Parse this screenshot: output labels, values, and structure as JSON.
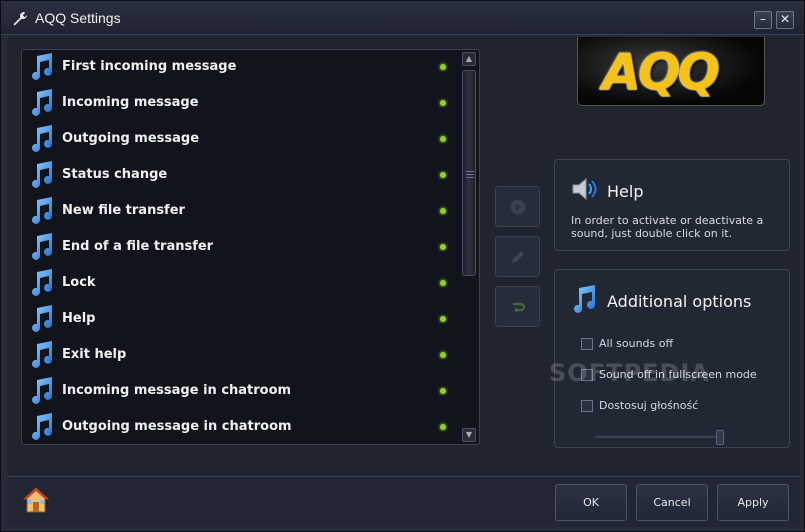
{
  "window": {
    "title": "AQQ Settings",
    "minimize_glyph": "–",
    "close_glyph": "✕"
  },
  "logo": {
    "text": "AQQ"
  },
  "sound_list": {
    "items": [
      {
        "label": "First incoming message",
        "enabled": true
      },
      {
        "label": "Incoming message",
        "enabled": true
      },
      {
        "label": "Outgoing message",
        "enabled": true
      },
      {
        "label": "Status change",
        "enabled": true
      },
      {
        "label": "New file transfer",
        "enabled": true
      },
      {
        "label": "End of a file transfer",
        "enabled": true
      },
      {
        "label": "Lock",
        "enabled": true
      },
      {
        "label": "Help",
        "enabled": true
      },
      {
        "label": "Exit help",
        "enabled": true
      },
      {
        "label": "Incoming message in chatroom",
        "enabled": true
      },
      {
        "label": "Outgoing message in chatroom",
        "enabled": true
      }
    ],
    "status_color": "#8fd12b"
  },
  "help_panel": {
    "title": "Help",
    "text": "In order to activate or deactivate a sound, just double click on it."
  },
  "options_panel": {
    "title": "Additional options",
    "options": [
      {
        "label": "All sounds off",
        "checked": false
      },
      {
        "label": "Sound off in fullscreen mode",
        "checked": false
      },
      {
        "label": "Dostosuj głośność",
        "checked": false
      }
    ],
    "volume_level": 0.93
  },
  "watermark": "SOFTPEDIA",
  "footer": {
    "ok_label": "OK",
    "cancel_label": "Cancel",
    "apply_label": "Apply"
  },
  "icons": {
    "title": "wrench-icon",
    "list_item": "music-note-icon",
    "play": "play-icon",
    "edit": "pencil-icon",
    "reset": "reset-arrow-icon",
    "help": "speaker-icon",
    "options": "music-note-icon",
    "home": "home-icon"
  }
}
